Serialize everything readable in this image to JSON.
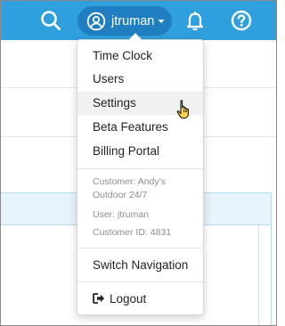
{
  "topbar": {
    "search_icon": "search-icon",
    "username": "jtruman",
    "avatar_icon": "user-circle-icon",
    "caret_icon": "caret-down-icon",
    "bell_icon": "bell-icon",
    "help_icon": "question-circle-icon",
    "background_color": "#2f9fde",
    "pill_color": "#1f7fc0"
  },
  "menu": {
    "items": [
      {
        "label": "Time Clock"
      },
      {
        "label": "Users"
      },
      {
        "label": "Settings"
      },
      {
        "label": "Beta Features"
      },
      {
        "label": "Billing Portal"
      }
    ],
    "hovered": "Settings",
    "info": {
      "customer": "Customer: Andy's Outdoor 24/7",
      "user": "User: jtruman",
      "customer_id": "Customer ID: 4831"
    },
    "switch_navigation": "Switch Navigation",
    "logout": "Logout",
    "logout_icon": "sign-out-icon"
  },
  "cursor": "hand-pointer-icon"
}
